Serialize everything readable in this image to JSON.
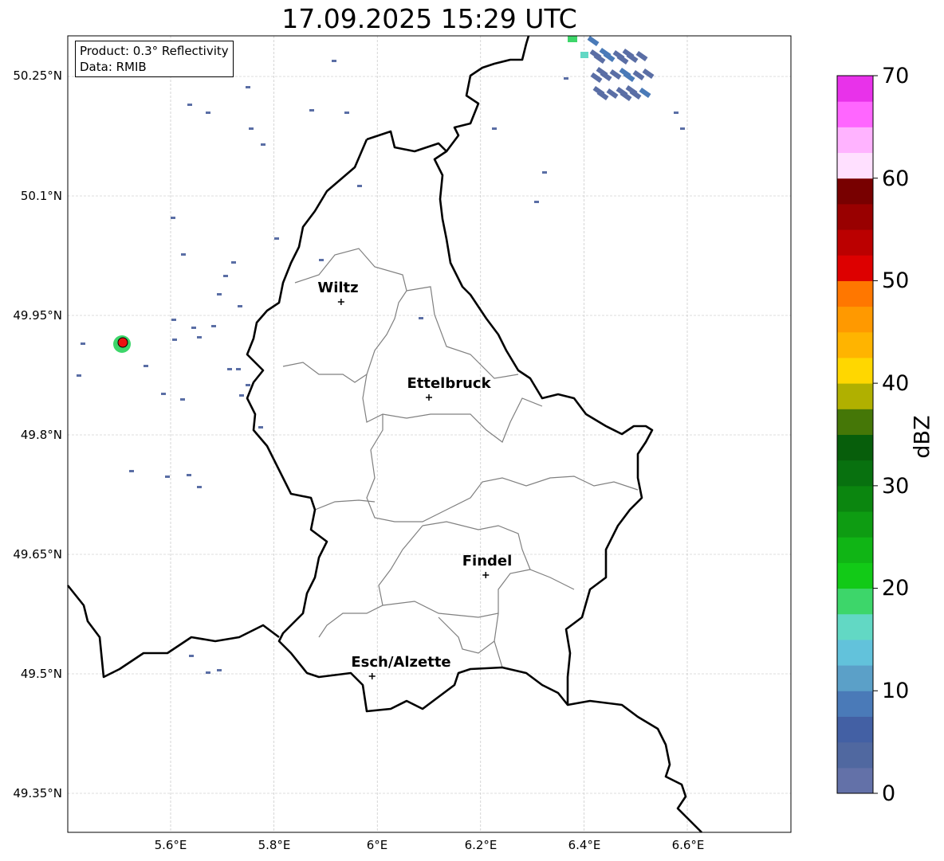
{
  "title": "17.09.2025 15:29 UTC",
  "info_box": {
    "product": "Product: 0.3° Reflectivity",
    "data_source": "Data: RMIB"
  },
  "axes": {
    "lat_ticks": [
      "50.25°N",
      "50.1°N",
      "49.95°N",
      "49.8°N",
      "49.65°N",
      "49.5°N",
      "49.35°N"
    ],
    "lon_ticks": [
      "5.6°E",
      "5.8°E",
      "6°E",
      "6.2°E",
      "6.4°E",
      "6.6°E"
    ]
  },
  "cities": [
    {
      "name": "Wiltz",
      "lon": 5.93,
      "lat": 49.967
    },
    {
      "name": "Ettelbruck",
      "lon": 6.1,
      "lat": 49.847
    },
    {
      "name": "Findel",
      "lon": 6.21,
      "lat": 49.624
    },
    {
      "name": "Esch/Alzette",
      "lon": 5.99,
      "lat": 49.497
    }
  ],
  "colorbar": {
    "label": "dBZ",
    "ticks": [
      "0",
      "10",
      "20",
      "30",
      "40",
      "50",
      "60",
      "70"
    ],
    "min": 0,
    "max": 70,
    "colors": [
      "#6371a8",
      "#5068a0",
      "#4360a4",
      "#4a7ab8",
      "#5ba0c8",
      "#62c2db",
      "#62d8c4",
      "#3dd66a",
      "#12ca17",
      "#10b515",
      "#0e9c12",
      "#0b860f",
      "#08710f",
      "#075e0b",
      "#457707",
      "#b0b000",
      "#ffd700",
      "#ffb400",
      "#ff9900",
      "#ff7700",
      "#dd0000",
      "#bb0000",
      "#990000",
      "#780000",
      "#ffe0ff",
      "#ffb3ff",
      "#ff66ff",
      "#e832ea"
    ]
  },
  "radar_site_color": "#ee1111"
}
